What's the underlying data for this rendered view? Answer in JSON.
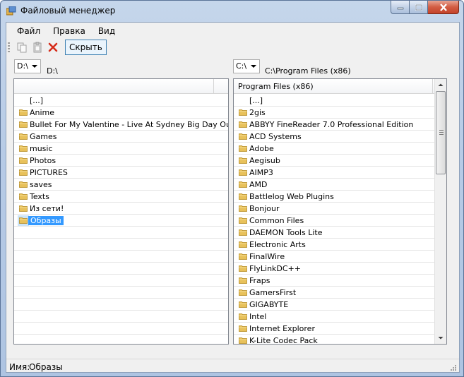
{
  "window": {
    "title": "Файловый менеджер"
  },
  "menu": [
    "Файл",
    "Правка",
    "Вид"
  ],
  "toolbar": {
    "hide_label": "Скрыть",
    "icons": [
      "copy-icon",
      "paste-icon",
      "delete-icon"
    ]
  },
  "left_panel": {
    "drive": "D:\\",
    "path": "D:\\",
    "header": "",
    "items": [
      "[...]",
      "Anime",
      "Bullet For My Valentine - Live At Sydney Big Day Ou...",
      "Games",
      "music",
      "Photos",
      "PICTURES",
      "saves",
      "Texts",
      "Из сети!",
      "Образы"
    ],
    "selected": "Образы"
  },
  "right_panel": {
    "drive": "C:\\",
    "path": "C:\\Program Files (x86)",
    "header": "Program Files (x86)",
    "items": [
      "[...]",
      "2gis",
      "ABBYY FineReader 7.0 Professional Edition",
      "ACD Systems",
      "Adobe",
      "Aegisub",
      "AIMP3",
      "AMD",
      "Battlelog Web Plugins",
      "Bonjour",
      "Common Files",
      "DAEMON Tools Lite",
      "Electronic Arts",
      "FinalWire",
      "FlyLinkDC++",
      "Fraps",
      "GamersFirst",
      "GIGABYTE",
      "Intel",
      "Internet Explorer",
      "K-Lite Codec Pack"
    ]
  },
  "status": {
    "name_label": "Имя:",
    "name_value": "Образы"
  },
  "colors": {
    "selection": "#3399ff",
    "folder": "#e8c15a",
    "title_bar": "#b9cde7"
  }
}
